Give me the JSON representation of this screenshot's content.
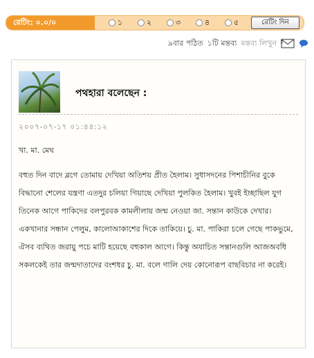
{
  "rating": {
    "label": "রেটিং: ০.০/০",
    "options": [
      "১",
      "২",
      "৩",
      "৪",
      "৫"
    ],
    "button_label": "রেটিং দিন"
  },
  "meta": {
    "read_count": "৯বার পঠিত",
    "comment_count": "১টি মন্তব্য",
    "write_comment": "মন্তব্য লিখুন"
  },
  "post": {
    "author_heading": "পথহারা বলেছেন :",
    "timestamp": "২০০৭-০৭-১৭ ০১:৪৪:১২",
    "greeting": "খা. মা. মেঘ",
    "body": "বহুত দিন বাদে ব্লগে তোমায় দেখিয়া অতিশয় প্রীত হৈলাম। সুধাসদনের পিশাচীনির বুকে বিদ্ধানো শেলের যন্ত্রণা এতদুর চলিয়া গিয়াছে দেখিয়া পুলকিত হৈলাম। খুবই ইচ্ছাছিল যুগ তিনেক আগে পাকিদের বলপুরবক কামলীলায় জন্ম নেওয়া জা. সন্তান কাউকে দেখার। একখানার সন্ধান পেলুম, কালোআকাশের দিকে তাকিয়ে। চু. মা. পাকিরা চলে গেছে পাকভুমে, ঐসব ব্যথিত জরায়ু পচে মাটি হয়েছে বহুকাল আগে। কিন্তু অযাচিত সন্তানগুলি আজঅবধি সকলকেই তার জন্মদাতাদের বংশধর চু. মা. বলে গালি দেয় কোনোরূপ বাছবিচার না করেই।"
  },
  "colors": {
    "rating_bar": "#fbd9a9",
    "rating_label": "#f39a2c"
  },
  "icons": [
    "mail-icon",
    "chat-icon"
  ]
}
